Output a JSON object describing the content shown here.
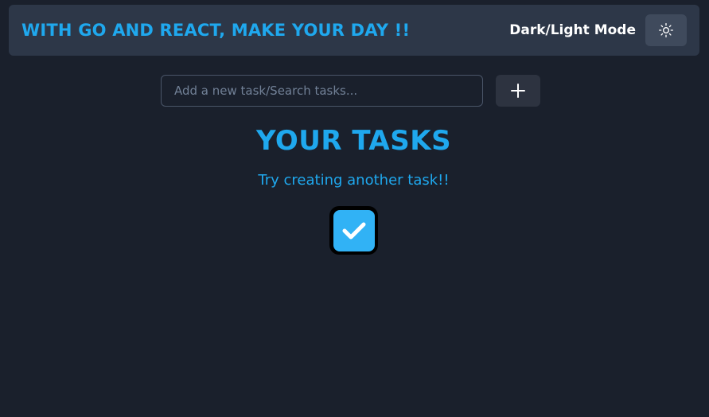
{
  "navbar": {
    "brand": "WITH GO AND REACT, MAKE YOUR DAY !!",
    "mode_label": "Dark/Light Mode",
    "mode_icon": "sun-icon"
  },
  "task_form": {
    "placeholder": "Add a new task/Search tasks...",
    "value": "",
    "add_icon": "plus-icon"
  },
  "main": {
    "heading": "YOUR TASKS",
    "empty_message": "Try creating another task!!",
    "empty_icon": "check-square-icon"
  },
  "colors": {
    "accent": "#1fa8ee",
    "background": "#1a202c",
    "navbar": "#2d3748"
  }
}
